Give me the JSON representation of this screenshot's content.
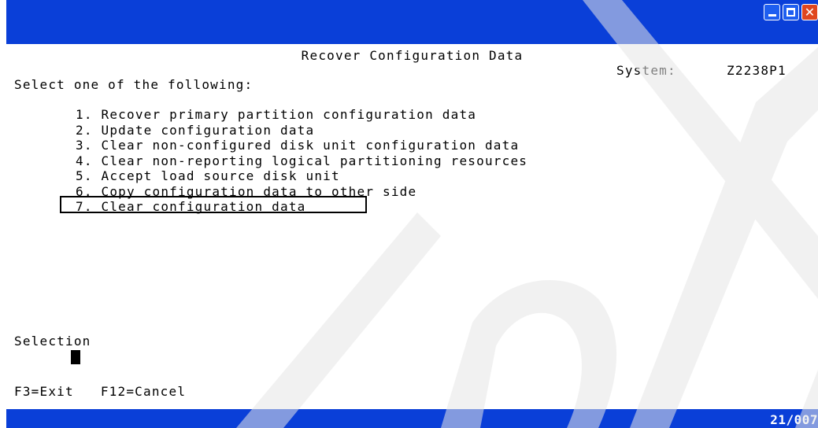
{
  "window": {
    "buttons": {
      "minimize_icon": "minimize-icon",
      "maximize_icon": "maximize-icon",
      "close_icon": "close-icon",
      "close_glyph": "✕"
    },
    "colors": {
      "bar": "#0a3fd8",
      "text": "#000000",
      "background": "#ffffff"
    }
  },
  "screen": {
    "title": "Recover Configuration Data",
    "system_label": "System:",
    "system_value": "Z2238P1",
    "prompt": "Select one of the following:",
    "options": [
      "1. Recover primary partition configuration data",
      "2. Update configuration data",
      "3. Clear non-configured disk unit configuration data",
      "4. Clear non-reporting logical partitioning resources",
      "5. Accept load source disk unit",
      "6. Copy configuration data to other side",
      "7. Clear configuration data"
    ],
    "selection_label": "Selection",
    "selection_value": "",
    "function_keys": [
      "F3=Exit",
      "F12=Cancel"
    ]
  },
  "status": {
    "cursor_position": "21/007"
  }
}
